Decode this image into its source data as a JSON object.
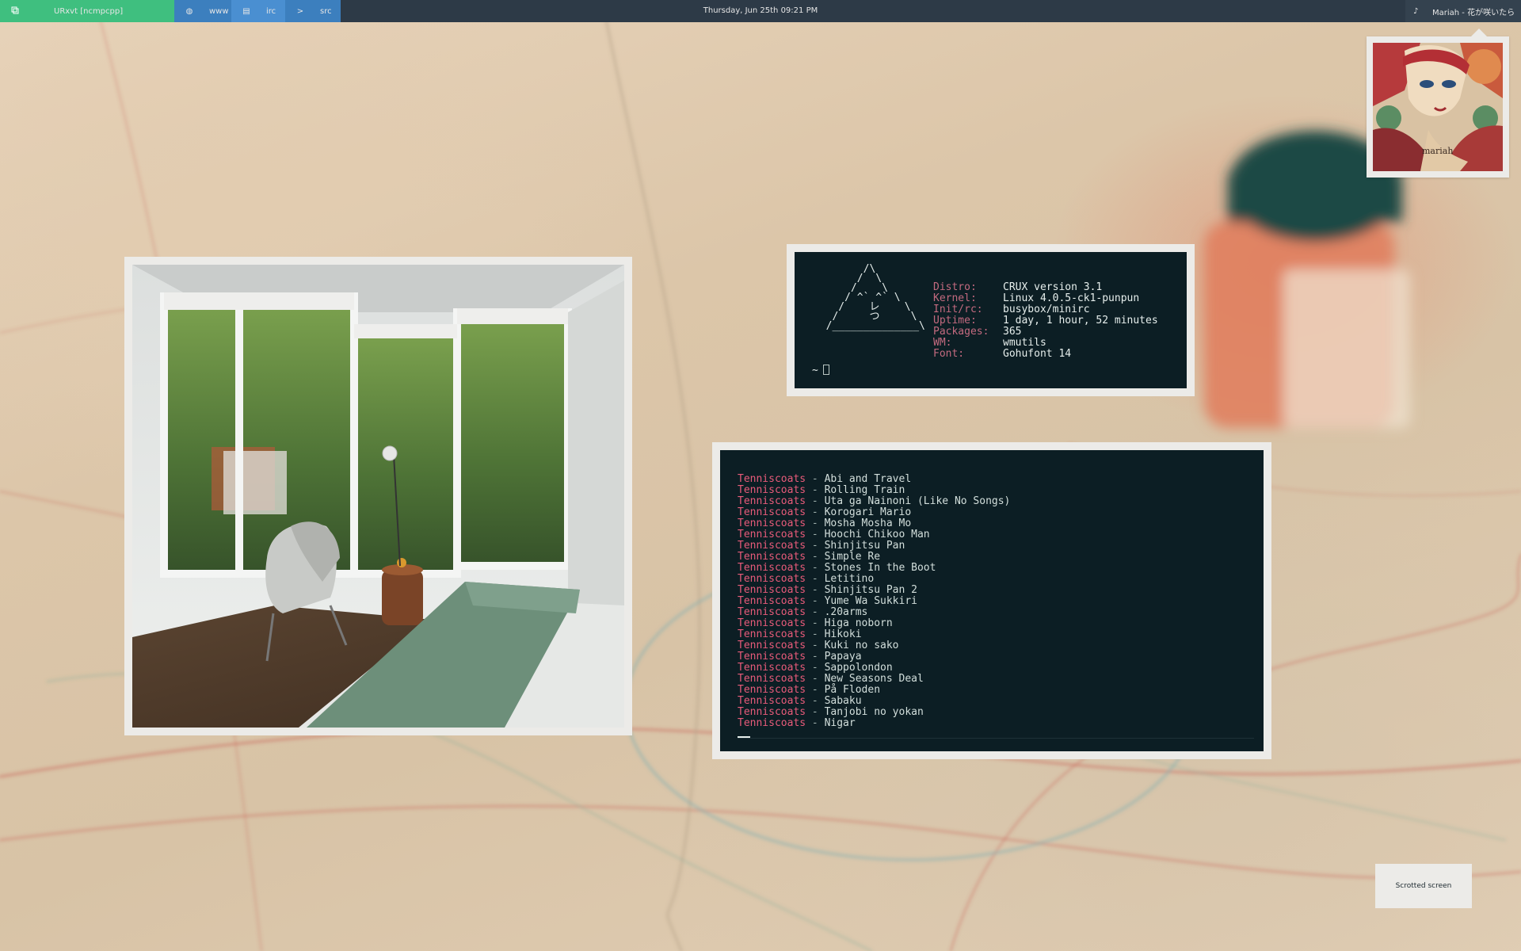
{
  "bar": {
    "active_window": "URxvt [ncmpcpp]",
    "active_icon": "terminal-icon",
    "workspaces": [
      {
        "label": "www",
        "icon": "globe-icon"
      },
      {
        "label": "irc",
        "icon": "chat-icon"
      },
      {
        "label": "src",
        "icon": "code-icon"
      }
    ],
    "clock": "Thursday, Jun 25th 09:21 PM",
    "now_playing": "Mariah - 花が咲いたら",
    "music_icon": "music-note-icon",
    "colors": {
      "bar": "#2d3a47",
      "active": "#3fbf7f",
      "workspace": "#3c7fbe"
    }
  },
  "album": {
    "art_text": "mariah"
  },
  "fetch": {
    "ascii_logo": "        /\\\n       /  \\\n      /    \\\n     / ^` ^` \\\n    /    レ    \\\n   /     つ     \\\n  /______________\\",
    "prompt": "~",
    "info": [
      {
        "key": "Distro:",
        "value": "CRUX version 3.1"
      },
      {
        "key": "Kernel:",
        "value": "Linux 4.0.5-ck1-punpun"
      },
      {
        "key": "Init/rc:",
        "value": "busybox/minirc"
      },
      {
        "key": "Uptime:",
        "value": "1 day, 1 hour, 52 minutes"
      },
      {
        "key": "Packages:",
        "value": "365"
      },
      {
        "key": "WM:",
        "value": "wmutils"
      },
      {
        "key": "Font:",
        "value": "Gohufont 14"
      }
    ]
  },
  "playlist": {
    "artist": "Tenniscoats",
    "separator": " - ",
    "tracks": [
      "Abi and Travel",
      "Rolling Train",
      "Uta ga Nainoni (Like No Songs)",
      "Korogari Mario",
      "Mosha Mosha Mo",
      "Hoochi Chikoo Man",
      "Shinjitsu Pan",
      "Simple Re",
      "Stones In the Boot",
      "Letitino",
      "Shinjitsu Pan 2",
      "Yume Wa Sukkiri",
      ".20arms",
      "Higa noborn",
      "Hikoki",
      "Kuki no sako",
      "Papaya",
      "Sappolondon",
      "New Seasons Deal",
      "På Floden",
      "Sabaku",
      "Tanjobi no yokan",
      "Nigar"
    ],
    "colors": {
      "artist": "#e85b7a",
      "title": "#d3dfdc",
      "background": "#0c1e24"
    }
  },
  "notification": {
    "text": "Scrotted screen"
  }
}
